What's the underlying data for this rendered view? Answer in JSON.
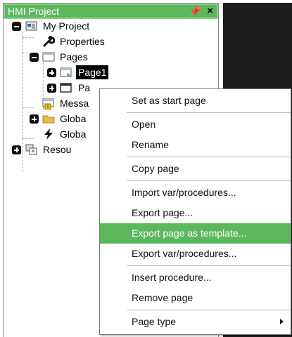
{
  "panel": {
    "title": "HMI Project",
    "pin_glyph": "⍡",
    "close_glyph": "✕"
  },
  "tree": {
    "root": "My Project",
    "properties": "Properties",
    "pages": "Pages",
    "page1": "Page1",
    "page2_partial": "Pa",
    "messages_partial": "Messa",
    "global1_partial": "Globa",
    "global2_partial": "Globa",
    "resources_partial": "Resou"
  },
  "context_menu": {
    "items": [
      "Set as start page",
      "Open",
      "Rename",
      "Copy page",
      "Import var/procedures...",
      "Export page...",
      "Export page as template...",
      "Export var/procedures...",
      "Insert procedure...",
      "Remove page",
      "Page type"
    ],
    "highlighted": "Export page as template..."
  },
  "colors": {
    "accent": "#5cb85c",
    "dark_area": "#1e1e1e"
  }
}
